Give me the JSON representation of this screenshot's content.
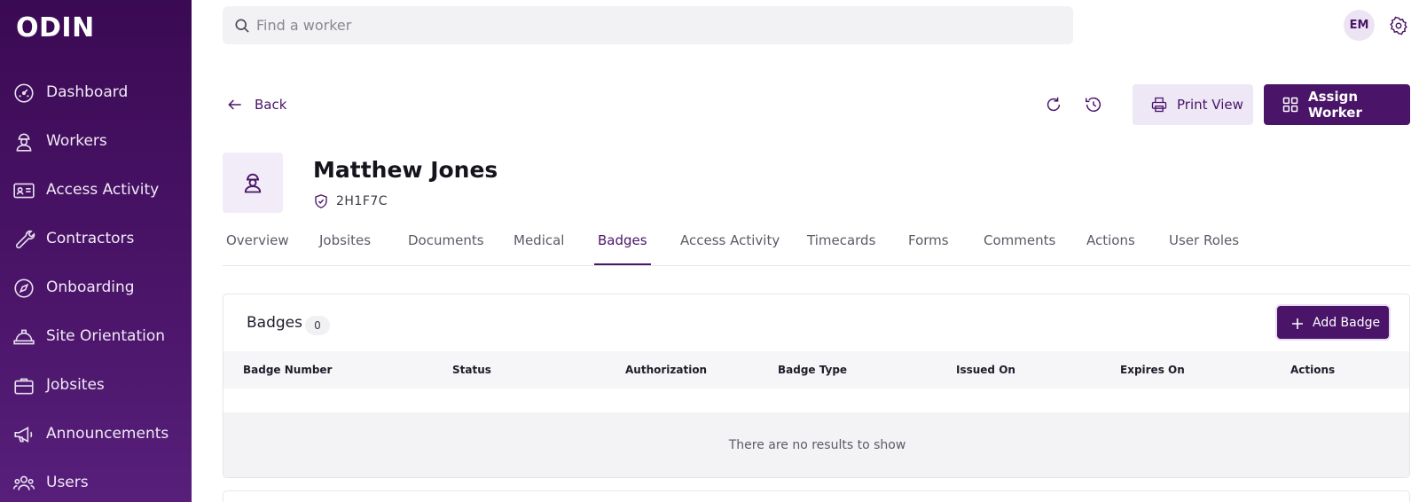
{
  "sidebar": {
    "logo": "ODIN",
    "items": [
      {
        "label": "Dashboard",
        "icon": "dashboard-gauge-icon"
      },
      {
        "label": "Workers",
        "icon": "worker-icon"
      },
      {
        "label": "Access Activity",
        "icon": "id-card-icon"
      },
      {
        "label": "Contractors",
        "icon": "wrench-icon"
      },
      {
        "label": "Onboarding",
        "icon": "compass-icon"
      },
      {
        "label": "Site Orientation",
        "icon": "hard-hat-icon"
      },
      {
        "label": "Jobsites",
        "icon": "briefcase-icon"
      },
      {
        "label": "Announcements",
        "icon": "megaphone-icon"
      },
      {
        "label": "Users",
        "icon": "users-icon"
      }
    ]
  },
  "header": {
    "search_placeholder": "Find a worker",
    "avatar_initials": "EM"
  },
  "actions": {
    "back_label": "Back",
    "print_label": "Print View",
    "assign_label": "Assign Worker"
  },
  "worker": {
    "name": "Matthew Jones",
    "code": "2H1F7C"
  },
  "tabs": [
    {
      "label": "Overview"
    },
    {
      "label": "Jobsites"
    },
    {
      "label": "Documents"
    },
    {
      "label": "Medical"
    },
    {
      "label": "Badges",
      "active": true
    },
    {
      "label": "Access Activity"
    },
    {
      "label": "Timecards"
    },
    {
      "label": "Forms"
    },
    {
      "label": "Comments"
    },
    {
      "label": "Actions"
    },
    {
      "label": "User Roles"
    }
  ],
  "badges": {
    "title": "Badges",
    "count": "0",
    "add_label": "Add Badge",
    "columns": [
      "Badge Number",
      "Status",
      "Authorization",
      "Badge Type",
      "Issued On",
      "Expires On",
      "Actions"
    ],
    "empty_text": "There are no results to show"
  },
  "colors": {
    "brand": "#4a1468",
    "sidebar_top": "#3b0a54",
    "sidebar_bottom": "#571f7a",
    "accent_light": "#ede7f6"
  }
}
